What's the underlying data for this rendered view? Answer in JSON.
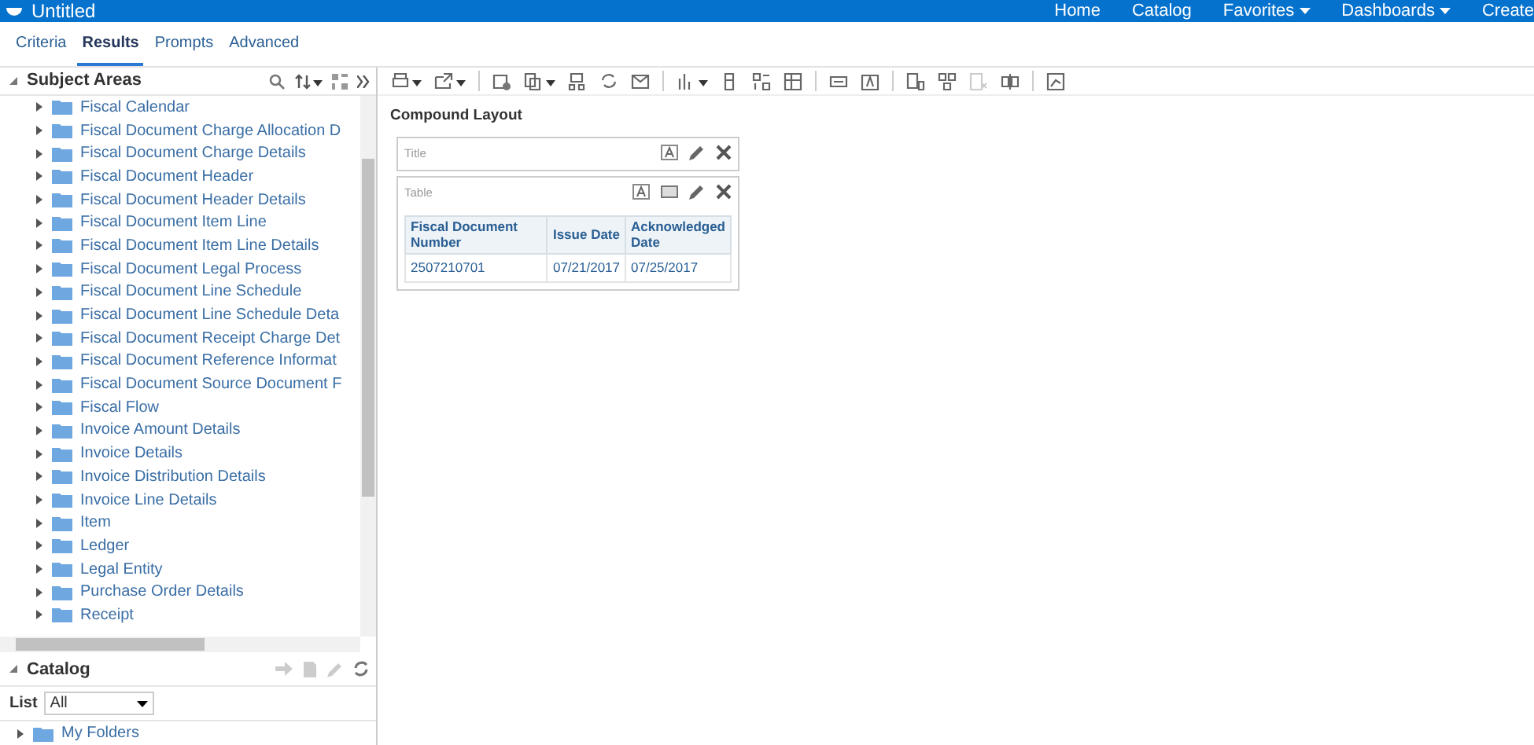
{
  "header": {
    "title": "Untitled",
    "nav": [
      {
        "label": "Home",
        "menu": false
      },
      {
        "label": "Catalog",
        "menu": false
      },
      {
        "label": "Favorites",
        "menu": true
      },
      {
        "label": "Dashboards",
        "menu": true
      },
      {
        "label": "Create",
        "menu": false
      }
    ]
  },
  "tabs": [
    {
      "label": "Criteria",
      "selected": false
    },
    {
      "label": "Results",
      "selected": true
    },
    {
      "label": "Prompts",
      "selected": false
    },
    {
      "label": "Advanced",
      "selected": false
    }
  ],
  "subject_areas": {
    "title": "Subject Areas",
    "items": [
      {
        "label": "Fiscal Calendar",
        "expanded": false
      },
      {
        "label": "Fiscal Document Charge Allocation D",
        "expanded": false
      },
      {
        "label": "Fiscal Document Charge Details",
        "expanded": false
      },
      {
        "label": "Fiscal Document Header",
        "expanded": false
      },
      {
        "label": "Fiscal Document Header Details",
        "expanded": false
      },
      {
        "label": "Fiscal Document Item Line",
        "expanded": false
      },
      {
        "label": "Fiscal Document Item Line Details",
        "expanded": false
      },
      {
        "label": "Fiscal Document Legal Process",
        "expanded": false
      },
      {
        "label": "Fiscal Document Line Schedule",
        "expanded": false
      },
      {
        "label": "Fiscal Document Line Schedule Deta",
        "expanded": false
      },
      {
        "label": "Fiscal Document Receipt Charge Det",
        "expanded": false
      },
      {
        "label": "Fiscal Document Reference Informat",
        "expanded": false
      },
      {
        "label": "Fiscal Document Source Document F",
        "expanded": false
      },
      {
        "label": "Fiscal Flow",
        "expanded": false
      },
      {
        "label": "Invoice Amount Details",
        "expanded": false
      },
      {
        "label": "Invoice Details",
        "expanded": false
      },
      {
        "label": "Invoice Distribution Details",
        "expanded": false
      },
      {
        "label": "Invoice Line Details",
        "expanded": false
      },
      {
        "label": "Item",
        "expanded": false
      },
      {
        "label": "Ledger",
        "expanded": false
      },
      {
        "label": "Legal Entity",
        "expanded": false
      },
      {
        "label": "Purchase Order Details",
        "expanded": false
      },
      {
        "label": "Receipt",
        "expanded": false
      }
    ]
  },
  "catalog": {
    "title": "Catalog",
    "list_label": "List",
    "list_value": "All",
    "items": [
      {
        "label": "My Folders",
        "expanded": false
      }
    ]
  },
  "layout": {
    "title": "Compound Layout",
    "views": [
      {
        "kind": "title",
        "label": "Title"
      },
      {
        "kind": "table",
        "label": "Table"
      }
    ],
    "table": {
      "columns": [
        "Fiscal Document Number",
        "Issue Date",
        "Acknowledged Date"
      ],
      "rows": [
        [
          "2507210701",
          "07/21/2017",
          "07/25/2017"
        ]
      ]
    }
  }
}
